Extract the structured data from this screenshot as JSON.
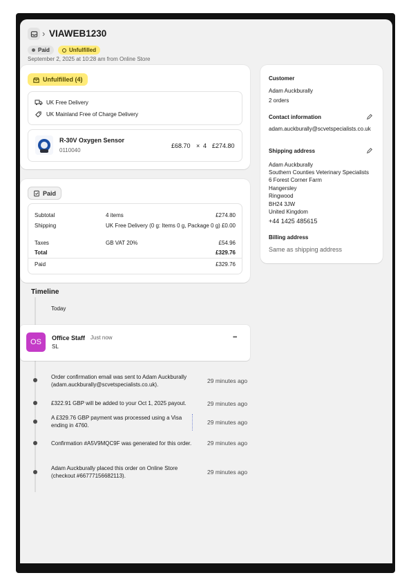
{
  "header": {
    "breadcrumb_sep": "›",
    "order_id": "VIAWEB1230",
    "paid_badge": "Paid",
    "fulfillment_badge": "Unfulfilled",
    "subtitle": "September 2, 2025 at 10:28 am from Online Store"
  },
  "fulfillment": {
    "badge": "Unfulfilled (4)",
    "delivery_method": "UK Free Delivery",
    "discount": "UK Mainland Free of Charge Delivery",
    "item": {
      "name": "R-30V Oxygen Sensor",
      "sku": "0110040",
      "unit_price": "£68.70",
      "times": "×",
      "quantity": "4",
      "total": "£274.80"
    }
  },
  "payment": {
    "badge": "Paid",
    "rows": {
      "subtotal": {
        "label": "Subtotal",
        "desc": "4 items",
        "amount": "£274.80"
      },
      "shipping": {
        "label": "Shipping",
        "desc": "UK Free Delivery (0 g: Items 0 g, Package 0 g)",
        "amount": "£0.00"
      },
      "taxes": {
        "label": "Taxes",
        "desc": "GB VAT 20%",
        "amount": "£54.96"
      },
      "total": {
        "label": "Total",
        "amount": "£329.76"
      },
      "paid": {
        "label": "Paid",
        "amount": "£329.76"
      }
    }
  },
  "timeline": {
    "title": "Timeline",
    "day": "Today",
    "comment": {
      "initials": "OS",
      "author": "Office Staff",
      "time": "Just now",
      "text": "SL",
      "more": "•••"
    },
    "events": [
      {
        "text": "Order confirmation email was sent to Adam Auckburally (adam.auckburally@scvetspecialists.co.uk).",
        "time": "29 minutes ago"
      },
      {
        "text": "£322.91 GBP will be added to your Oct 1, 2025 payout.",
        "time": "29 minutes ago"
      },
      {
        "text": "A £329.76 GBP payment was processed using a Visa ending in 4760.",
        "time": "29 minutes ago"
      },
      {
        "text": "Confirmation #A5V9MQC9F was generated for this order.",
        "time": "29 minutes ago"
      },
      {
        "text": "Adam Auckburally placed this order on Online Store (checkout #66777156682113).",
        "time": "29 minutes ago"
      }
    ]
  },
  "customer": {
    "title": "Customer",
    "name": "Adam Auckburally",
    "orders": "2 orders",
    "contact_title": "Contact information",
    "email": "adam.auckburally@scvetspecialists.co.uk",
    "shipping_title": "Shipping address",
    "shipping_address": {
      "name": "Adam Auckburally",
      "company": "Southern Counties Veterinary Specialists",
      "line1": "6 Forest Corner Farm",
      "line2": "Hangersley",
      "city": "Ringwood",
      "postcode": "BH24 3JW",
      "country": "United Kingdom",
      "phone": "+44 1425 485615"
    },
    "billing_title": "Billing address",
    "billing_text": "Same as shipping address"
  },
  "colors": {
    "paid_badge_bg": "#e3e3e3",
    "unfulfilled_bg": "#ffeb78",
    "avatar_bg": "#c43bc7"
  }
}
